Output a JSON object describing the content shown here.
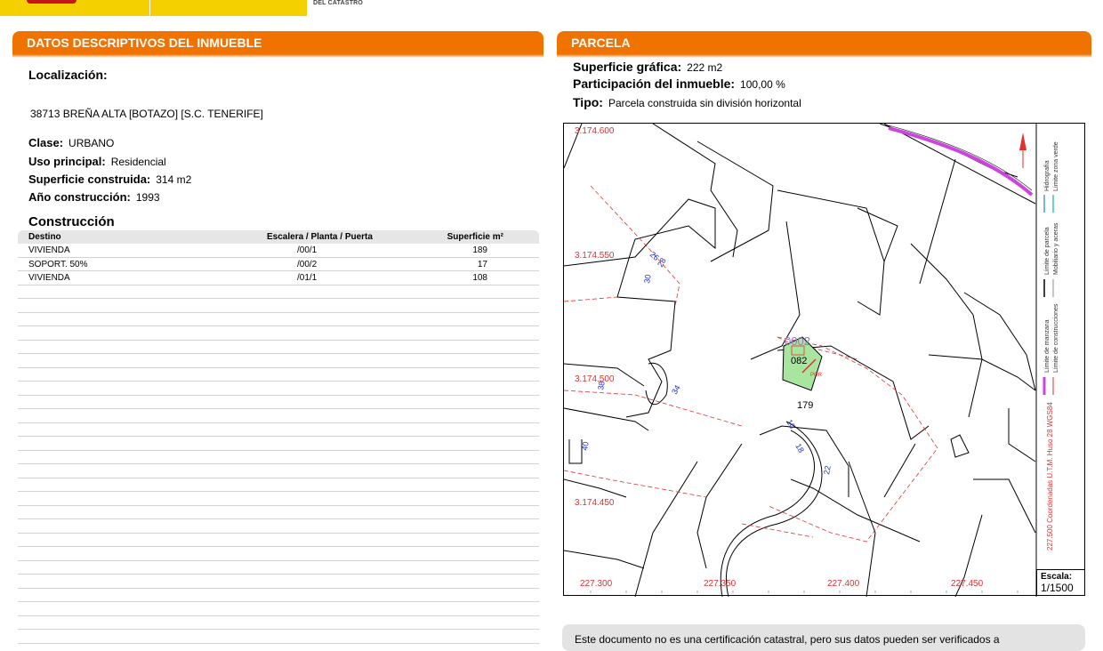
{
  "header": {
    "logo_text": "DEL CATASTRO"
  },
  "left_panel": {
    "title_prefix": "DATOS DESCRIPTIVOS DEL ",
    "title_bold": "INMUEBLE",
    "localizacion_label": "Localización:",
    "address": "38713 BREÑA ALTA [BOTAZO] [S.C. TENERIFE]",
    "clase": {
      "label": "Clase:",
      "value": "URBANO"
    },
    "uso": {
      "label": "Uso principal:",
      "value": "Residencial"
    },
    "superficie": {
      "label": "Superficie construida:",
      "value": "314 m2"
    },
    "anio": {
      "label": "Año construcción:",
      "value": "1993"
    },
    "construccion_title": "Construcción",
    "table": {
      "headers": [
        "Destino",
        "Escalera / Planta / Puerta",
        "Superficie m²"
      ],
      "rows": [
        [
          "VIVIENDA",
          "/00/1",
          "189"
        ],
        [
          "SOPORT. 50%",
          "/00/2",
          "17"
        ],
        [
          "VIVIENDA",
          "/01/1",
          "108"
        ]
      ]
    }
  },
  "right_panel": {
    "title": "PARCELA",
    "superficie_grafica": {
      "label": "Superficie gráfica:",
      "value": "222 m2"
    },
    "participacion": {
      "label": "Participación del inmueble:",
      "value": "100,00 %"
    },
    "tipo": {
      "label": "Tipo:",
      "value": "Parcela construida sin división horizontal"
    }
  },
  "map": {
    "y_labels": [
      "3.174.600",
      "3.174.550",
      "3.174.500",
      "3.174.450"
    ],
    "x_labels": [
      "227.300",
      "227.350",
      "227.400",
      "227.450"
    ],
    "parcel_labels": [
      "0002",
      "082",
      "179",
      "POR"
    ],
    "street_numbers": [
      "26",
      "28",
      "30",
      "34",
      "38",
      "40",
      "10",
      "18",
      "22"
    ],
    "coordinate_note": "227.500 Coordenadas U.T.M. Huso 28 WGS84",
    "legend": [
      "Límite de manzana",
      "Límite de construcciones",
      "Límite de parcela",
      "Mobiliario y aceras",
      "Hidrografía",
      "Límite zona verde"
    ],
    "scale_label": "Escala:",
    "scale_value": "1/1500",
    "colors": {
      "grid_label": "#e03030",
      "number": "#2030c0",
      "parcel_fill": "#a8e6a0",
      "magenta": "#cc44dd"
    }
  },
  "footer": {
    "note": "Este documento no es una certificación catastral, pero sus datos pueden ser verificados a"
  }
}
